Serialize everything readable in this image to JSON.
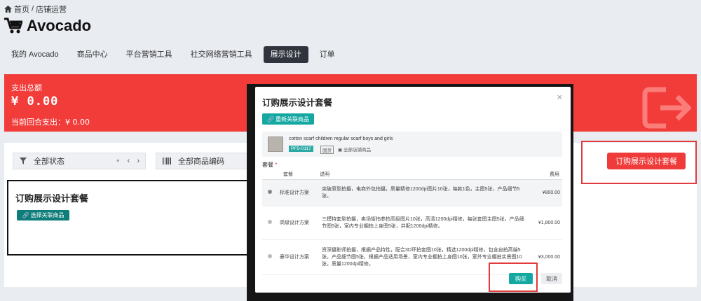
{
  "breadcrumb": {
    "home": "首页",
    "sep": "/",
    "current": "店铺运营"
  },
  "page": {
    "title": "Avocado"
  },
  "tabs": [
    "我的 Avocado",
    "商品中心",
    "平台营销工具",
    "社交网络营销工具",
    "展示设计",
    "订单"
  ],
  "summary": {
    "total_label": "支出总额",
    "total_value": "¥ 0.00",
    "round_label": "当前回合支出：¥ 0.00"
  },
  "filters": {
    "status": "全部状态",
    "sku": "全部商品编码"
  },
  "order_button": "订购展示设计套餐",
  "bg_card": {
    "title": "订购展示设计套餐",
    "select_button": "选择关联商品"
  },
  "modal": {
    "title": "订购展示设计套餐",
    "reselect_button": "重新关联商品",
    "product": {
      "name": "cotton scarf children regular scarf boys and girls",
      "sku": "PFS-0117",
      "tag": "国货",
      "tag2": "全部店铺商品"
    },
    "package_label": "套餐",
    "required_mark": "*",
    "columns": [
      "套餐",
      "说明",
      "费用"
    ],
    "packages": [
      {
        "name": "标准设计方案",
        "desc": "突破原型拍摄，电商外包拍摄，质量精修1200dpi图片10张，每款1色，主图5张，产品细节5张。",
        "price": "¥800.00"
      },
      {
        "name": "高级设计方案",
        "desc": "三模特套型拍摄，卖场街拍参拍高级图片10张，高清1200dpi精修，每张套图主图5张，产品细节图5张，室内专业棚拍上身图5张，并配1200dpi精修。",
        "price": "¥1,800.00"
      },
      {
        "name": "豪华设计方案",
        "desc": "资深摄影师拍摄，根据产品特性，配合3D环拍套图10张，精选1200dpi精修，包含自拍高端5张，产品细节图5张，根据产品适用场景，室内专业棚拍上身图10张，室外专业棚拍实景图10张，质量1200dpi精修。",
        "price": "¥3,000.00"
      }
    ],
    "confirm": "购买",
    "cancel": "取消"
  }
}
